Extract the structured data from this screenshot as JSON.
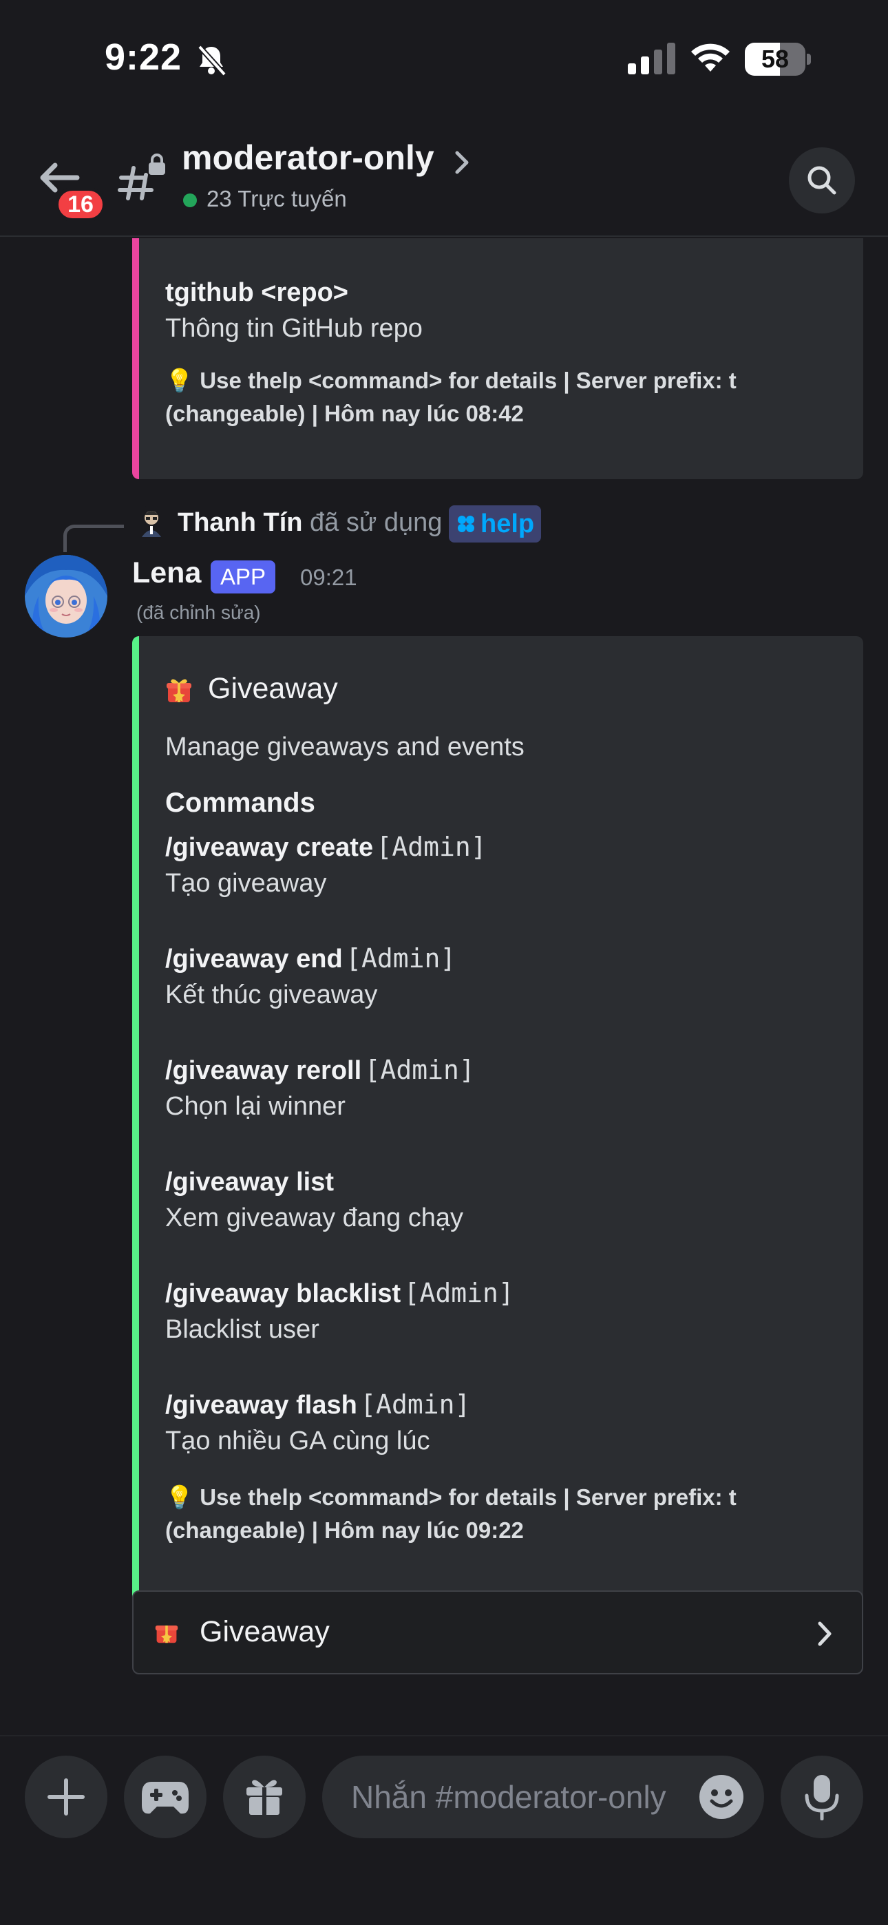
{
  "status_bar": {
    "time": "9:22",
    "battery": "58",
    "battery_level_percent": 58
  },
  "header": {
    "back_badge": "16",
    "channel_name": "moderator-only",
    "online_text": "23 Trực tuyến"
  },
  "previous_embed": {
    "command": "tgithub <repo>",
    "description": "Thông tin GitHub repo",
    "footer_line1": "💡 Use thelp <command> for details | Server prefix: t",
    "footer_line2": "(changeable) | Hôm nay lúc 08:42",
    "bar_color": "#eb459f"
  },
  "reply": {
    "user": "Thanh Tín",
    "action": "đã sử dụng",
    "command": "help"
  },
  "message": {
    "author": "Lena",
    "tag": "APP",
    "timestamp": "09:21",
    "edited": "(đã chỉnh sửa)"
  },
  "embed": {
    "bar_color": "#57f287",
    "title": "Giveaway",
    "description": "Manage giveaways and events",
    "section_title": "Commands",
    "commands": [
      {
        "name": "/giveaway create",
        "tag": "[Admin]",
        "desc": "Tạo giveaway"
      },
      {
        "name": "/giveaway end",
        "tag": "[Admin]",
        "desc": "Kết thúc giveaway"
      },
      {
        "name": "/giveaway reroll",
        "tag": "[Admin]",
        "desc": "Chọn lại winner"
      },
      {
        "name": "/giveaway list",
        "tag": "",
        "desc": "Xem giveaway đang chạy"
      },
      {
        "name": "/giveaway blacklist",
        "tag": "[Admin]",
        "desc": "Blacklist user"
      },
      {
        "name": "/giveaway flash",
        "tag": "[Admin]",
        "desc": "Tạo nhiều GA cùng lúc"
      }
    ],
    "footer_line1": "💡 Use thelp <command> for details | Server prefix: t",
    "footer_line2": "(changeable) | Hôm nay lúc 09:22"
  },
  "component": {
    "label": "Giveaway"
  },
  "composer": {
    "placeholder": "Nhắn #moderator-only"
  },
  "icons": {
    "back": "arrow-left-icon",
    "channel": "locked-hash-icon",
    "search": "search-icon",
    "add": "plus-icon",
    "game": "gamepad-icon",
    "gift": "gift-icon",
    "emoji": "emoji-icon",
    "mic": "microphone-icon"
  }
}
